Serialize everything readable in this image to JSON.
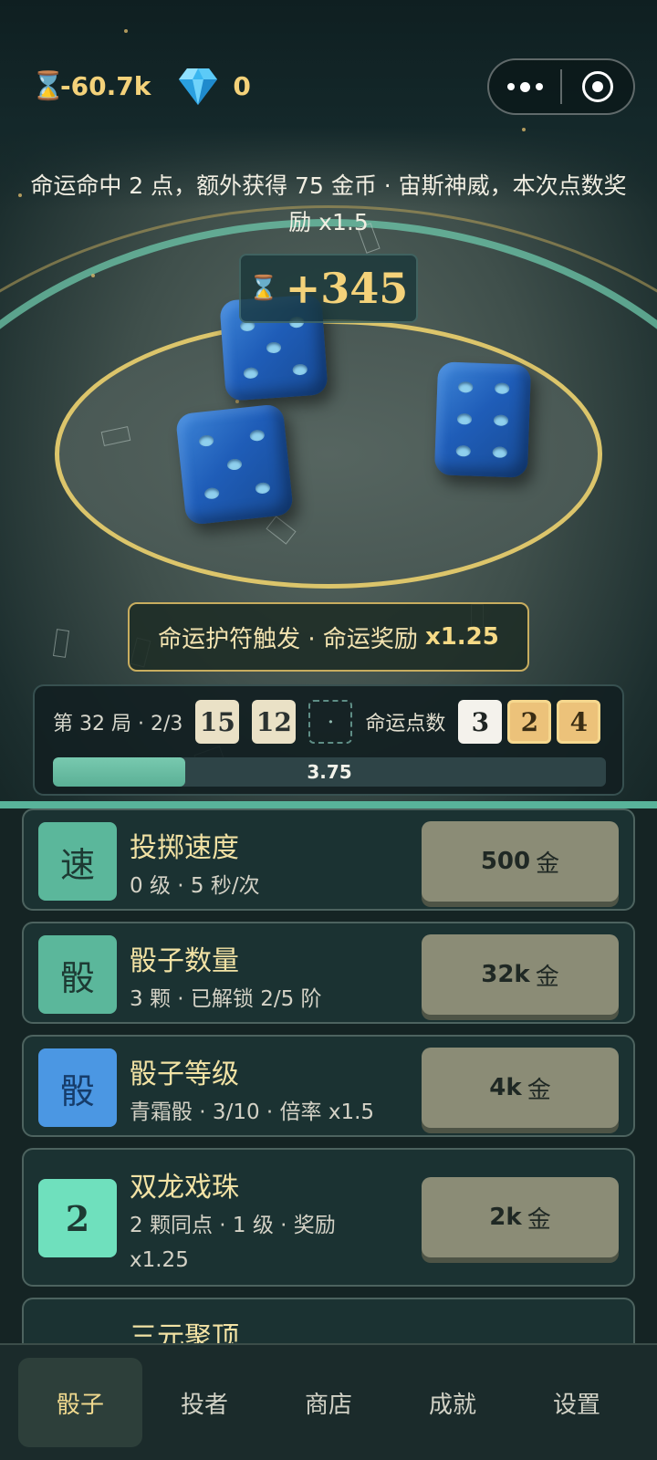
{
  "hud": {
    "coin_icon": "coin-icon",
    "coins": "-60.7k",
    "gem_icon": "diamond-icon",
    "gems": "0"
  },
  "miniprogram": {
    "more_icon": "more-dots-icon",
    "close_icon": "target-close-icon"
  },
  "message": "命运命中 2 点，额外获得 75 金币 · 宙斯神威，本次点数奖励 x1.5",
  "payout": {
    "coin_icon": "coin-icon",
    "amount": "+345"
  },
  "dice": [
    {
      "face": 5
    },
    {
      "face": 6
    },
    {
      "face": 5
    }
  ],
  "charm": {
    "text": "命运护符触发 · 命运奖励",
    "multiplier": "x1.25"
  },
  "round": {
    "label": "第 32 局 · 2/3",
    "rolls": [
      "15",
      "12"
    ],
    "pending": "·",
    "fate_label": "命运点数",
    "fate_numbers": [
      {
        "value": "3",
        "hit": false
      },
      {
        "value": "2",
        "hit": true
      },
      {
        "value": "4",
        "hit": true
      }
    ],
    "progress_text": "3.75",
    "progress_fraction": 0.24
  },
  "upgrades": [
    {
      "icon_char": "速",
      "icon_color": "#5bb79b",
      "title": "投掷速度",
      "sub": "0 级 · 5 秒/次",
      "price": "500",
      "unit": "金"
    },
    {
      "icon_char": "骰",
      "icon_color": "#5bb79b",
      "title": "骰子数量",
      "sub": "3 颗 · 已解锁 2/5 阶",
      "price": "32k",
      "unit": "金"
    },
    {
      "icon_char": "骰",
      "icon_color": "#4b97e3",
      "title": "骰子等级",
      "sub": "青霜骰 · 3/10 · 倍率 x1.5",
      "price": "4k",
      "unit": "金"
    },
    {
      "icon_char": "2",
      "icon_color": "#6fe0bd",
      "title": "双龙戏珠",
      "sub": "2 颗同点 · 1 级 · 奖励 x1.25",
      "price": "2k",
      "unit": "金"
    },
    {
      "icon_char": "",
      "icon_color": "#5bb79b",
      "title": "三元聚顶",
      "sub": "",
      "price": "",
      "unit": ""
    }
  ],
  "nav": [
    {
      "label": "骰子",
      "active": true
    },
    {
      "label": "投者",
      "active": false
    },
    {
      "label": "商店",
      "active": false
    },
    {
      "label": "成就",
      "active": false
    },
    {
      "label": "设置",
      "active": false
    }
  ],
  "colors": {
    "gold": "#f4d27a",
    "teal": "#5bb79b",
    "panel": "#1b3232"
  }
}
